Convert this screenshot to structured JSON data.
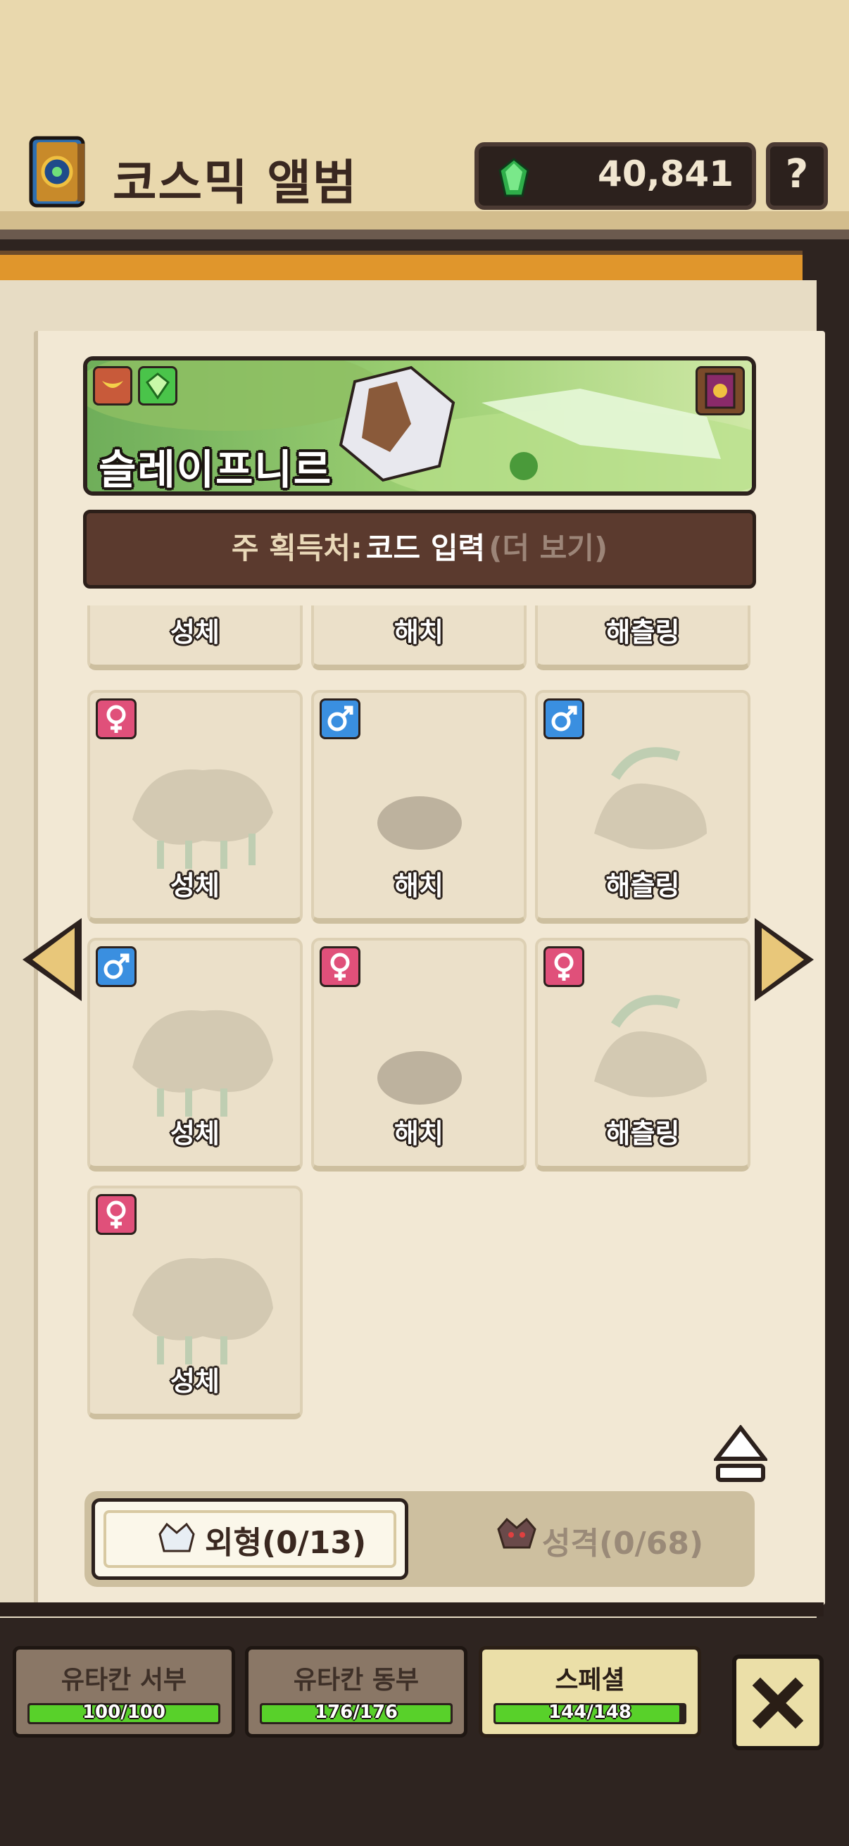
{
  "header": {
    "title": "코스믹 앨범",
    "currency_value": "40,841",
    "help_label": "?"
  },
  "banner": {
    "name": "슬레이프니르"
  },
  "source": {
    "label": "주 획득처:",
    "value": "코드 입력",
    "more": "(더 보기)"
  },
  "cards": [
    {
      "label": "성체",
      "gender": "none"
    },
    {
      "label": "해치",
      "gender": "none"
    },
    {
      "label": "해츨링",
      "gender": "none"
    },
    {
      "label": "성체",
      "gender": "female"
    },
    {
      "label": "해치",
      "gender": "male"
    },
    {
      "label": "해츨링",
      "gender": "male"
    },
    {
      "label": "성체",
      "gender": "male"
    },
    {
      "label": "해치",
      "gender": "female"
    },
    {
      "label": "해츨링",
      "gender": "female"
    },
    {
      "label": "성체",
      "gender": "female"
    }
  ],
  "tabs": {
    "appearance": "외형(0/13)",
    "personality": "성격(0/68)"
  },
  "regions": [
    {
      "label": "유타칸 서부",
      "progress_text": "100/100",
      "progress": 1.0,
      "active": false
    },
    {
      "label": "유타칸 동부",
      "progress_text": "176/176",
      "progress": 1.0,
      "active": false
    },
    {
      "label": "스페셜",
      "progress_text": "144/148",
      "progress": 0.973,
      "active": true
    }
  ],
  "colors": {
    "accent_green": "#58d12a",
    "female": "#e0507a",
    "male": "#3a8fe0"
  },
  "icons": [
    "album-book-icon",
    "crystal-icon",
    "help-icon",
    "wing-tag-icon",
    "gem-tag-icon",
    "collection-book-icon",
    "female-icon",
    "male-icon",
    "arrow-left-icon",
    "arrow-right-icon",
    "eject-icon",
    "appearance-mask-icon",
    "personality-mask-icon",
    "close-icon"
  ]
}
